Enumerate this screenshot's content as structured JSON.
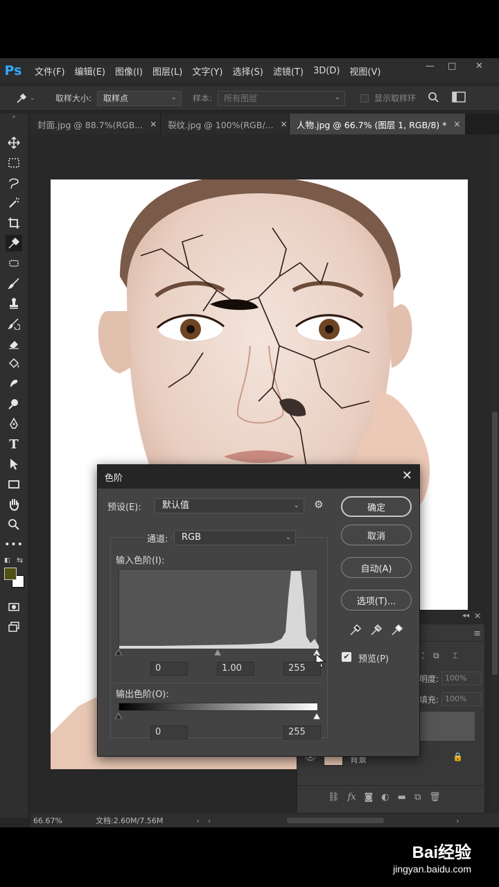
{
  "app": {
    "logo": "Ps"
  },
  "menubar": {
    "items": [
      "文件(F)",
      "编辑(E)",
      "图像(I)",
      "图层(L)",
      "文字(Y)",
      "选择(S)",
      "滤镜(T)",
      "3D(D)",
      "视图(V)"
    ],
    "window_controls": [
      "—",
      "□",
      "✕"
    ]
  },
  "options": {
    "sample_size_label": "取样大小:",
    "sample_size_value": "取样点",
    "sample_label": "样本:",
    "sample_value": "所有图层",
    "show_ring_label": "显示取样环"
  },
  "tabs": [
    {
      "label": "封面.jpg @ 88.7%(RGB...",
      "close": "×",
      "active": false
    },
    {
      "label": "裂纹.jpg @ 100%(RGB/...",
      "close": "×",
      "active": false
    },
    {
      "label": "人物.jpg @ 66.7% (图层 1, RGB/8) *",
      "close": "×",
      "active": true
    }
  ],
  "statusbar": {
    "zoom": "66.67%",
    "doc": "文档:2.60M/7.56M"
  },
  "layers": {
    "opacity_label": "明度:",
    "opacity_value": "100%",
    "fill_label": "填充:",
    "fill_value": "100%",
    "background_layer": "背景"
  },
  "levels": {
    "title": "色阶",
    "close": "✕",
    "preset_label": "预设(E):",
    "preset_value": "默认值",
    "channel_label": "通道:",
    "channel_value": "RGB",
    "input_label": "输入色阶(I):",
    "input_black": "0",
    "input_gamma": "1.00",
    "input_white": "255",
    "output_label": "输出色阶(O):",
    "output_black": "0",
    "output_white": "255",
    "buttons": {
      "ok": "确定",
      "cancel": "取消",
      "auto": "自动(A)",
      "options": "选项(T)..."
    },
    "preview_label": "预览(P)",
    "preview_checked": true
  },
  "watermark": {
    "logo": "Bai经验",
    "url": "jingyan.baidu.com"
  },
  "colors": {
    "foreground": "#4e5014",
    "background": "#ffffff",
    "accent": "#31a8ff"
  }
}
